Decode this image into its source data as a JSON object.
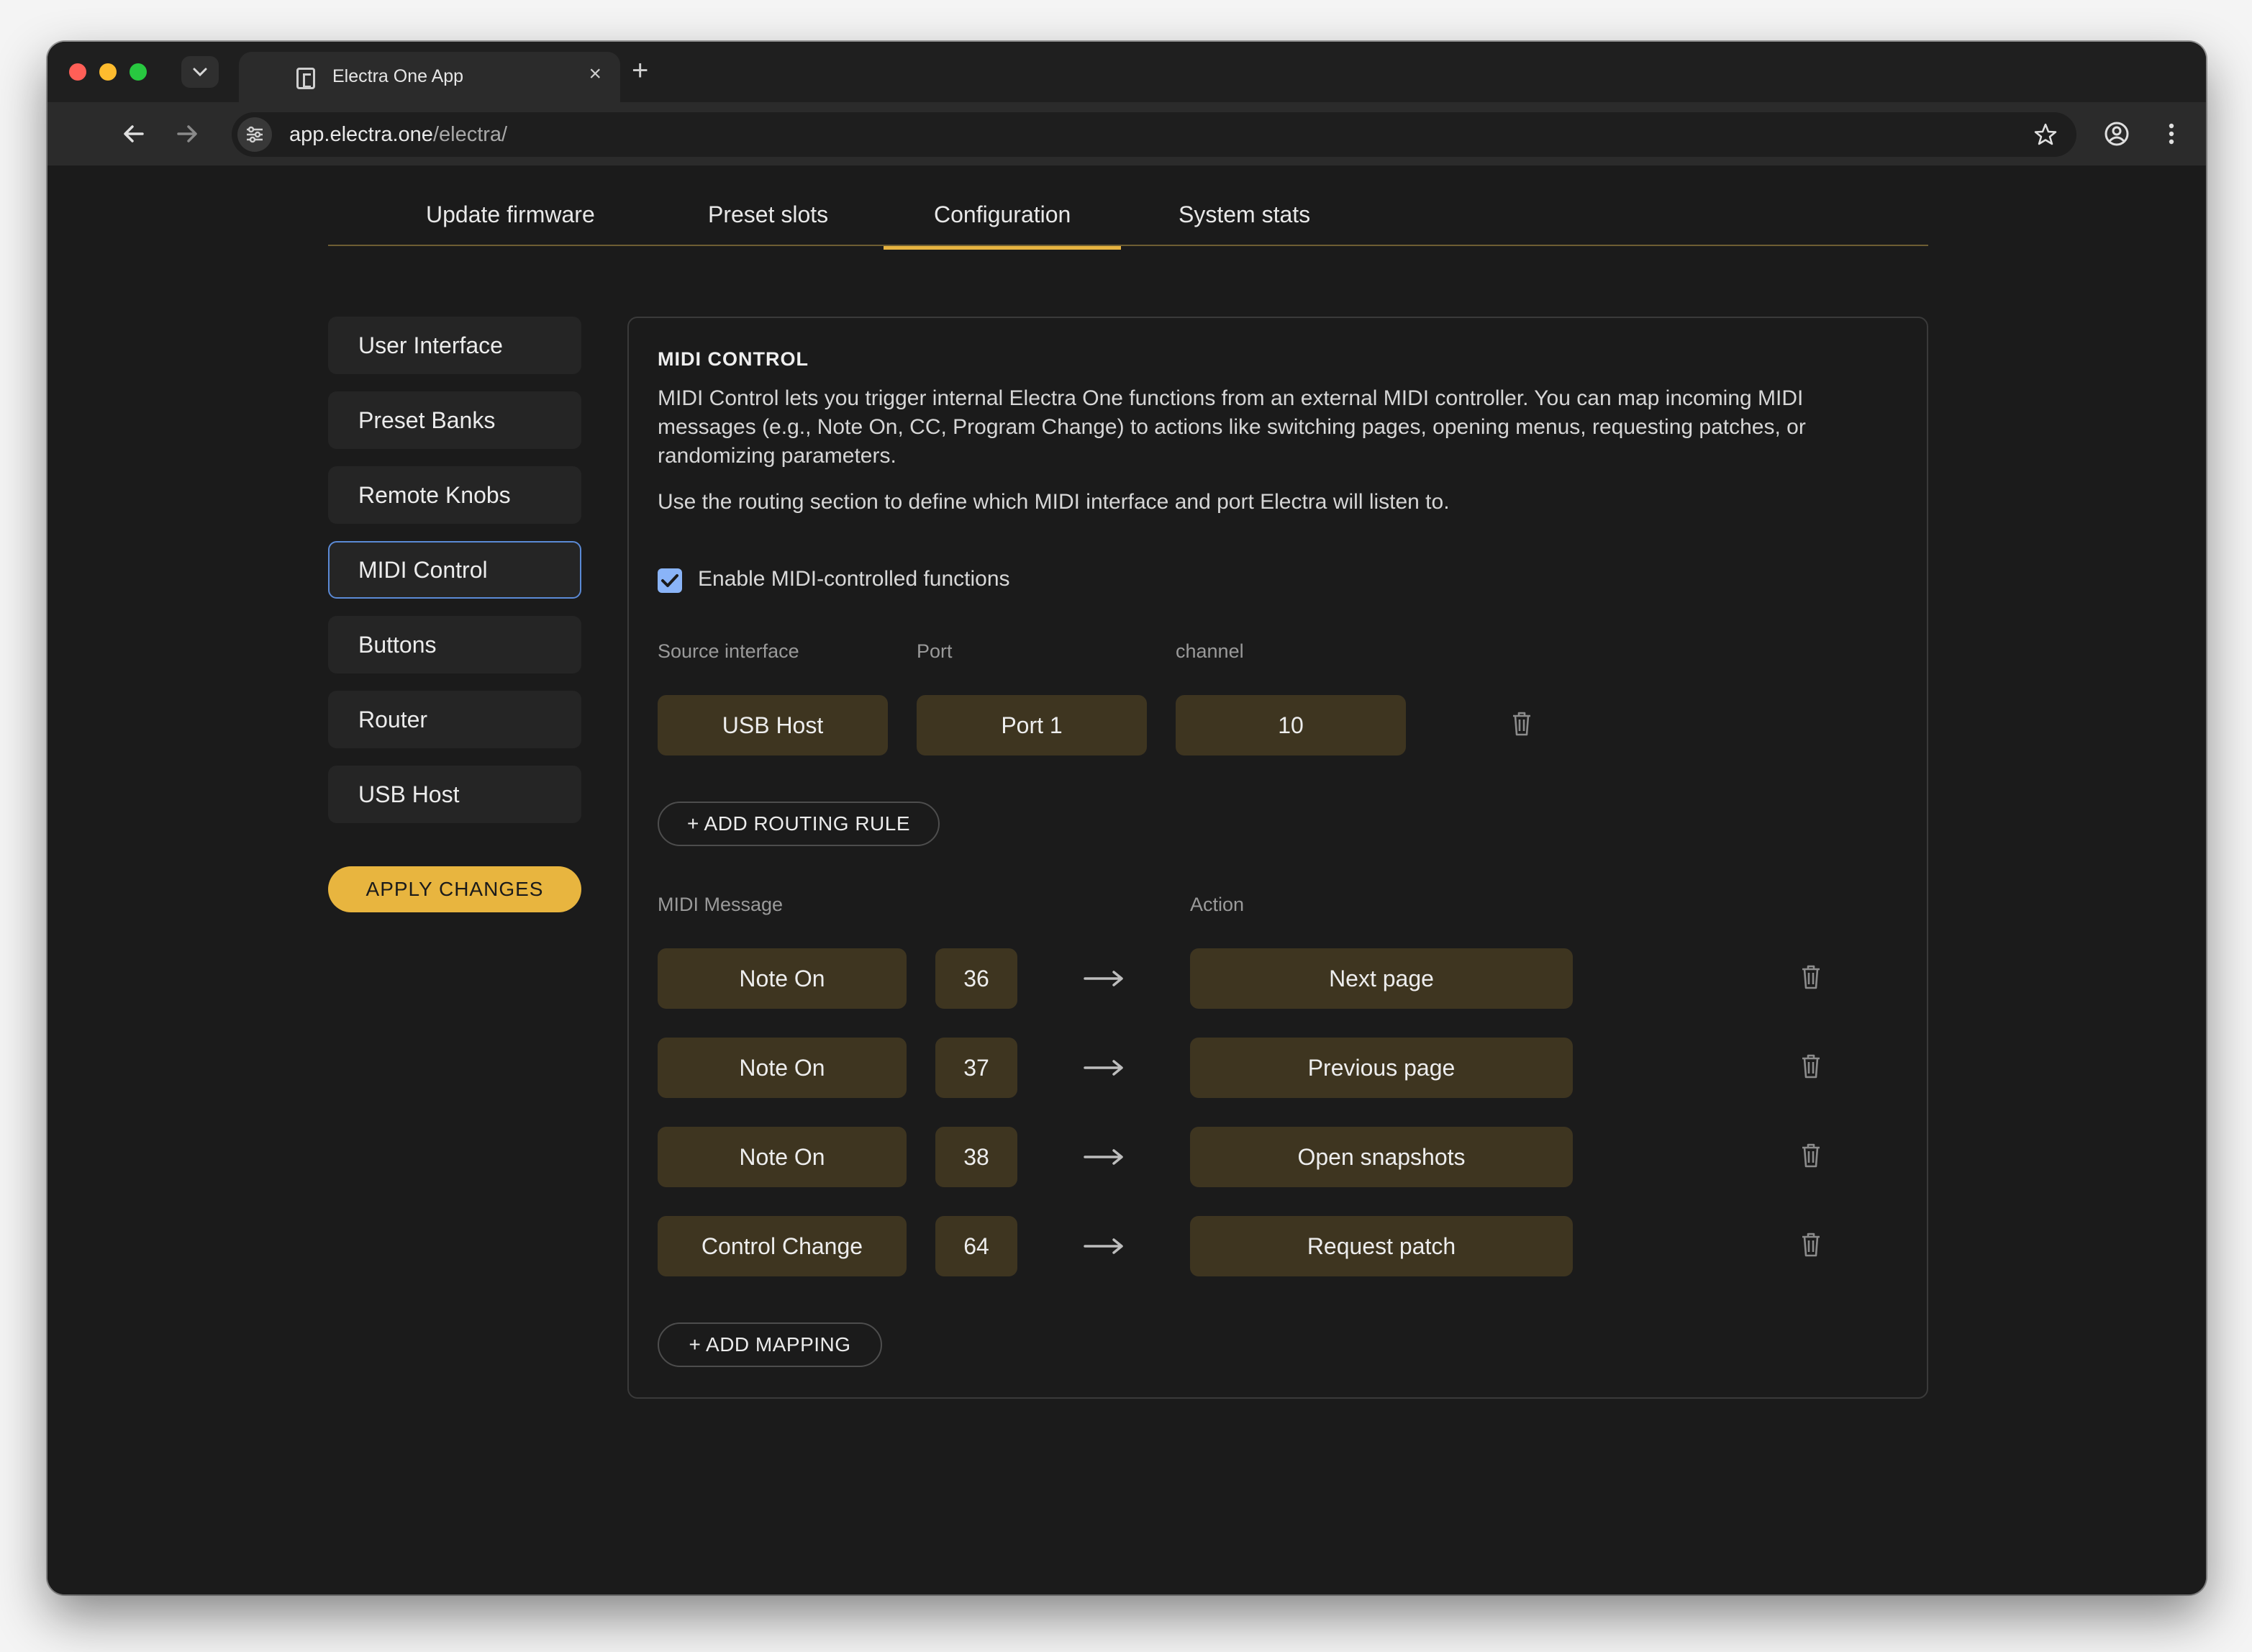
{
  "browser": {
    "tab_title": "Electra One App",
    "url_host": "app.electra.one",
    "url_path": "/electra/"
  },
  "main_tabs": [
    {
      "label": "Update firmware"
    },
    {
      "label": "Preset slots"
    },
    {
      "label": "Configuration",
      "active": true
    },
    {
      "label": "System stats"
    }
  ],
  "sidebar": {
    "items": [
      {
        "label": "User Interface"
      },
      {
        "label": "Preset Banks"
      },
      {
        "label": "Remote Knobs"
      },
      {
        "label": "MIDI Control",
        "active": true
      },
      {
        "label": "Buttons"
      },
      {
        "label": "Router"
      },
      {
        "label": "USB Host"
      }
    ],
    "apply_label": "APPLY CHANGES"
  },
  "midi_control": {
    "title": "MIDI CONTROL",
    "description_1": "MIDI Control lets you trigger internal Electra One functions from an external MIDI controller. You can map incoming MIDI messages (e.g., Note On, CC, Program Change) to actions like switching pages, opening menus, requesting patches, or randomizing parameters.",
    "description_2": "Use the routing section to define which MIDI interface and port Electra will listen to.",
    "enable_label": "Enable MIDI-controlled functions",
    "enabled": true,
    "routing_headers": {
      "source": "Source interface",
      "port": "Port",
      "channel": "channel"
    },
    "routing_rules": [
      {
        "source": "USB Host",
        "port": "Port 1",
        "channel": "10"
      }
    ],
    "add_routing_label": "+ ADD ROUTING RULE",
    "mapping_headers": {
      "message": "MIDI Message",
      "action": "Action"
    },
    "mappings": [
      {
        "message": "Note On",
        "number": "36",
        "action": "Next page"
      },
      {
        "message": "Note On",
        "number": "37",
        "action": "Previous page"
      },
      {
        "message": "Note On",
        "number": "38",
        "action": "Open snapshots"
      },
      {
        "message": "Control Change",
        "number": "64",
        "action": "Request patch"
      }
    ],
    "add_mapping_label": "+ ADD MAPPING"
  },
  "colors": {
    "accent": "#e8b53f",
    "pill_bg": "#3e3520",
    "checkbox": "#8ab4f8",
    "active_sidebar_border": "#5b8ad6"
  }
}
